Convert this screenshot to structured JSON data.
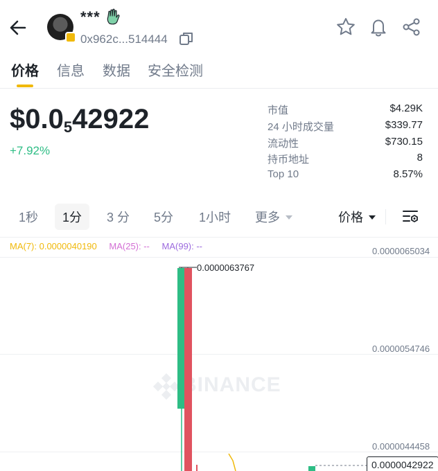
{
  "header": {
    "token_name": "***",
    "address": "0x962c...514444",
    "icons": [
      "back-arrow-icon",
      "wave-hand-icon",
      "copy-icon",
      "star-icon",
      "bell-icon",
      "share-icon"
    ]
  },
  "tabs": [
    {
      "label": "价格",
      "active": true
    },
    {
      "label": "信息",
      "active": false
    },
    {
      "label": "数据",
      "active": false
    },
    {
      "label": "安全检测",
      "active": false
    }
  ],
  "price": {
    "prefix": "$0.0",
    "zeros": "5",
    "digits": "42922",
    "change": "+7.92%",
    "change_color": "#2ebd85"
  },
  "stats": [
    {
      "label": "市值",
      "value": "$4.29K"
    },
    {
      "label": "24 小时成交量",
      "value": "$339.77"
    },
    {
      "label": "流动性",
      "value": "$730.15"
    },
    {
      "label": "持币地址",
      "value": "8"
    },
    {
      "label": "Top 10",
      "value": "8.57%"
    }
  ],
  "intervals": {
    "items": [
      "1秒",
      "1分",
      "3 分",
      "5分",
      "1小时",
      "更多"
    ],
    "selected": "1分",
    "price_type": "价格"
  },
  "chart": {
    "ma7": "MA(7): 0.0000040190",
    "ma25": "MA(25): --",
    "ma99": "MA(99): --",
    "watermark": "BINANCE",
    "y_labels": [
      "0.0000065034",
      "0.0000054746",
      "0.0000044458"
    ],
    "high_label": "0.0000063767",
    "current_label": "0.0000042922",
    "up_color": "#2ebd85",
    "down_color": "#e0535f"
  }
}
